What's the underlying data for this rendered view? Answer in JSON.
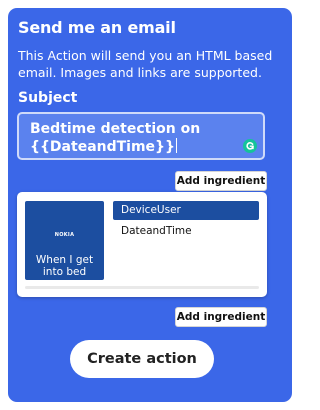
{
  "header": {
    "title": "Send me an email",
    "description": "This Action will send you an HTML based email. Images and links are supported."
  },
  "subject": {
    "label": "Subject",
    "value_line1": "Bedtime detection on",
    "value_line2": "{{DateandTime}}"
  },
  "add_ingredient_label": "Add ingredient",
  "ingredient_picker": {
    "thumbnail": {
      "logo_text": "NOKIA",
      "caption": "When I get into bed",
      "color": "#1c4ea0"
    },
    "items": [
      {
        "label": "DeviceUser",
        "selected": true
      },
      {
        "label": "DateandTime",
        "selected": false
      }
    ]
  },
  "create_action_label": "Create action",
  "colors": {
    "card_background": "#3b67e8",
    "field_background": "#5b82ee",
    "selected_item": "#1c4ea0",
    "grammar_icon": "#15c39a"
  }
}
